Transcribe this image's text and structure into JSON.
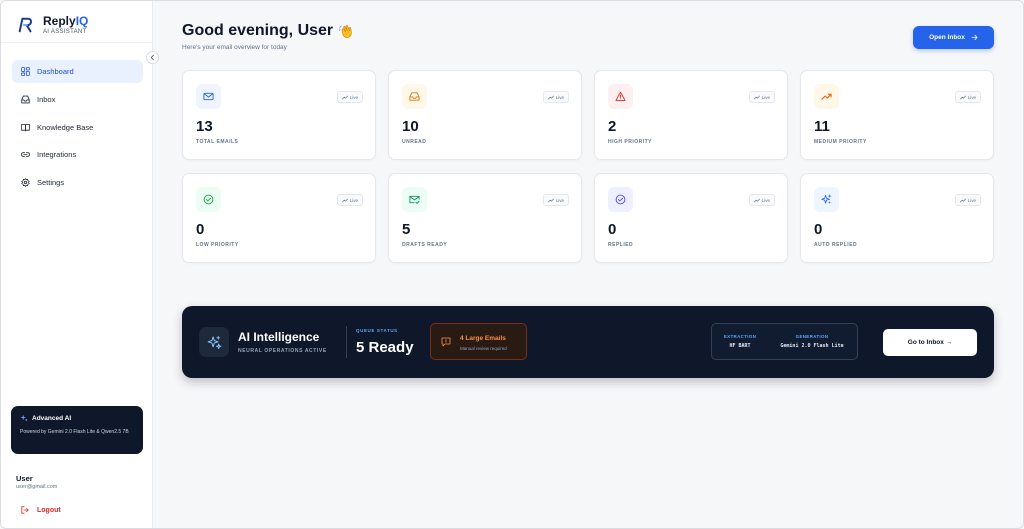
{
  "brand": {
    "name_main": "Reply",
    "name_accent": "IQ",
    "subtitle": "AI ASSISTANT"
  },
  "sidebar": {
    "items": [
      {
        "label": "Dashboard",
        "icon": "dashboard-icon",
        "active": true
      },
      {
        "label": "Inbox",
        "icon": "inbox-icon"
      },
      {
        "label": "Knowledge Base",
        "icon": "book-icon"
      },
      {
        "label": "Integrations",
        "icon": "link-icon"
      },
      {
        "label": "Settings",
        "icon": "gear-icon"
      }
    ],
    "ai_card": {
      "title": "Advanced AI",
      "text": "Powered by Gemini 2.0 Flash Lite & Qwen2.5 7B"
    },
    "user": {
      "name": "User",
      "email": "user@gmail.com"
    },
    "logout_label": "Logout"
  },
  "header": {
    "greeting": "Good evening, User",
    "subtitle": "Here's your email overview for today",
    "open_inbox_label": "Open Inbox"
  },
  "stats": [
    {
      "value": "13",
      "label": "TOTAL EMAILS",
      "badge": "Live",
      "icon": "mail-icon",
      "color": "#2563eb",
      "bg": "#eff5ff"
    },
    {
      "value": "10",
      "label": "UNREAD",
      "badge": "Live",
      "icon": "inbox-tray-icon",
      "color": "#d97706",
      "bg": "#fff7e8"
    },
    {
      "value": "2",
      "label": "HIGH PRIORITY",
      "badge": "Live",
      "icon": "alert-triangle-icon",
      "color": "#dc2626",
      "bg": "#fef0f0"
    },
    {
      "value": "11",
      "label": "MEDIUM PRIORITY",
      "badge": "Live",
      "icon": "trending-up-icon",
      "color": "#ea580c",
      "bg": "#fff7e8"
    },
    {
      "value": "0",
      "label": "LOW PRIORITY",
      "badge": "Live",
      "icon": "check-circle-icon",
      "color": "#16a34a",
      "bg": "#ecfdf3"
    },
    {
      "value": "5",
      "label": "DRAFTS READY",
      "badge": "Live",
      "icon": "mail-check-icon",
      "color": "#059669",
      "bg": "#ecfdf5"
    },
    {
      "value": "0",
      "label": "REPLIED",
      "badge": "Live",
      "icon": "check-circle-icon",
      "color": "#4f46e5",
      "bg": "#eef0ff"
    },
    {
      "value": "0",
      "label": "AUTO REPLIED",
      "badge": "Live",
      "icon": "sparkles-icon",
      "color": "#2563eb",
      "bg": "#eff5ff"
    }
  ],
  "banner": {
    "title": "AI Intelligence",
    "subtitle": "NEURAL OPERATIONS ACTIVE",
    "queue_label": "QUEUE STATUS",
    "queue_value": "5 Ready",
    "large_title": "4 Large Emails",
    "large_sub": "Manual review required",
    "extraction_label": "EXTRACTION",
    "extraction_value": "HF BART",
    "generation_label": "GENERATION",
    "generation_value": "Gemini 2.0 Flash Lite",
    "go_inbox_label": "Go to Inbox →"
  }
}
